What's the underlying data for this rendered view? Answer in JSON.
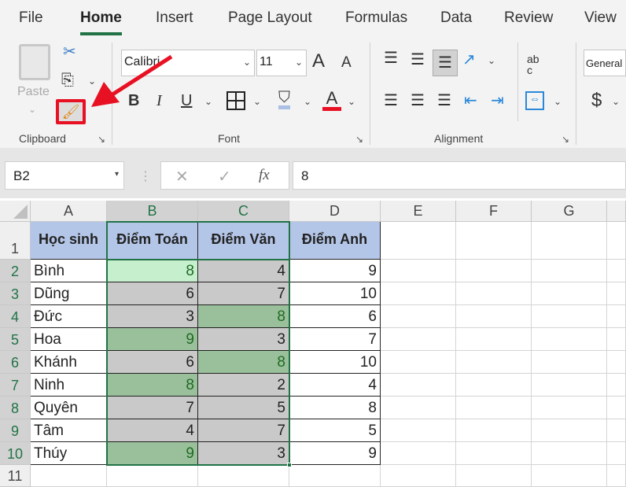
{
  "menu": {
    "tabs": [
      "File",
      "Home",
      "Insert",
      "Page Layout",
      "Formulas",
      "Data",
      "Review",
      "View"
    ],
    "active": "Home"
  },
  "ribbon": {
    "clipboard": {
      "paste": "Paste",
      "label": "Clipboard"
    },
    "font": {
      "name": "Calibri",
      "size": "11",
      "label": "Font",
      "bold": "B",
      "italic": "I",
      "underline": "U",
      "font_color": "A",
      "grow": "A",
      "shrink": "A"
    },
    "alignment": {
      "label": "Alignment",
      "wrap": "ab c"
    },
    "number": {
      "format": "General",
      "currency": "$"
    }
  },
  "formula_bar": {
    "name_box": "B2",
    "value": "8",
    "fx": "fx"
  },
  "sheet": {
    "columns": [
      "A",
      "B",
      "C",
      "D",
      "E",
      "F",
      "G"
    ],
    "rows": [
      "1",
      "2",
      "3",
      "4",
      "5",
      "6",
      "7",
      "8",
      "9",
      "10",
      "11"
    ],
    "headers": [
      "Học sinh",
      "Điểm Toán",
      "Điểm Văn",
      "Điểm Anh"
    ],
    "data": [
      [
        "Bình",
        8,
        4,
        9
      ],
      [
        "Dũng",
        6,
        7,
        10
      ],
      [
        "Đức",
        3,
        8,
        6
      ],
      [
        "Hoa",
        9,
        3,
        7
      ],
      [
        "Khánh",
        6,
        8,
        10
      ],
      [
        "Ninh",
        8,
        2,
        4
      ],
      [
        "Quyên",
        7,
        5,
        8
      ],
      [
        "Tâm",
        4,
        7,
        5
      ],
      [
        "Thúy",
        9,
        3,
        9
      ]
    ],
    "fills": [
      [
        "lgreen",
        "gray"
      ],
      [
        "gray",
        "gray"
      ],
      [
        "gray",
        "green"
      ],
      [
        "green",
        "gray"
      ],
      [
        "gray",
        "green"
      ],
      [
        "green",
        "gray"
      ],
      [
        "gray",
        "gray"
      ],
      [
        "gray",
        "gray"
      ],
      [
        "green",
        "gray"
      ]
    ]
  },
  "colors": {
    "accent": "#217346",
    "highlight": "#e81123",
    "header_fill": "#b4c6e7"
  }
}
